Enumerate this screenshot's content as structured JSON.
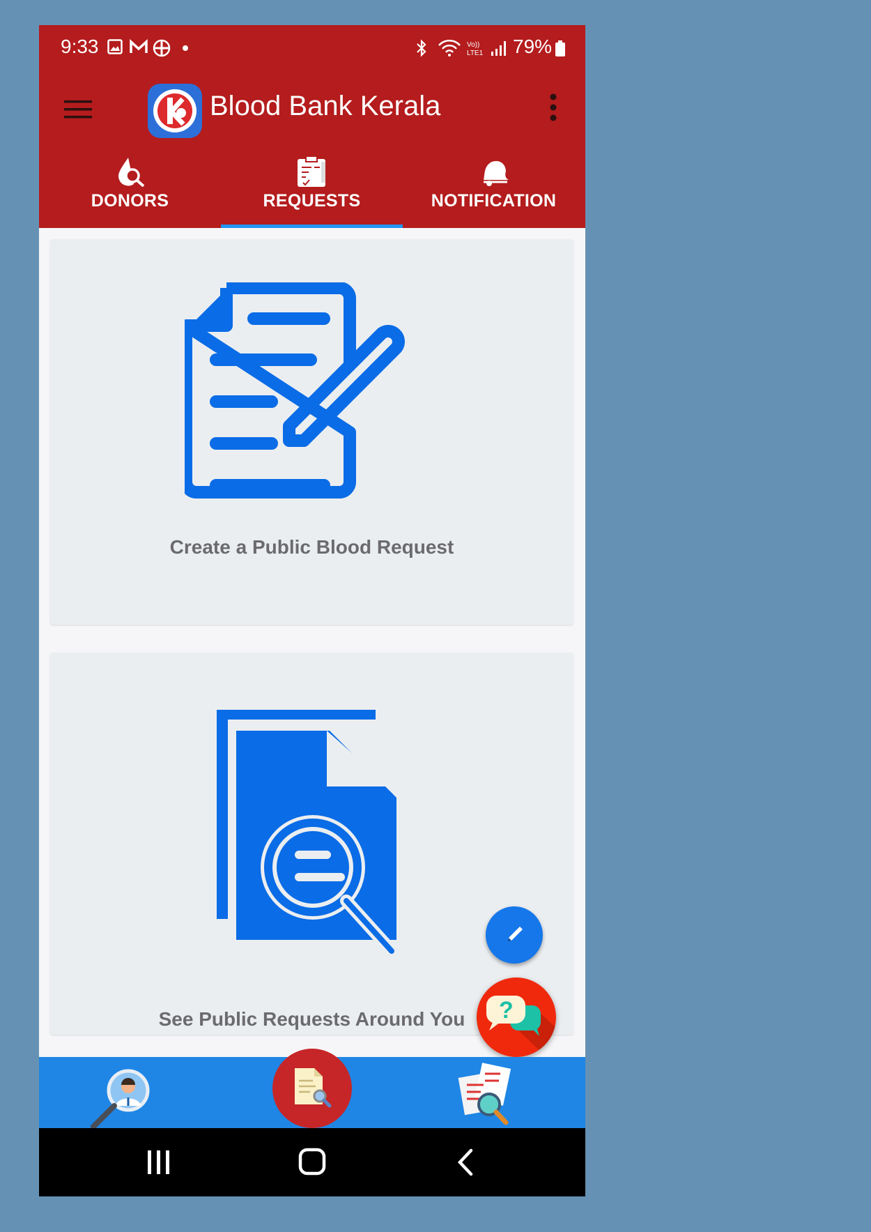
{
  "status_bar": {
    "time": "9:33",
    "battery": "79%",
    "icons": [
      "image-icon",
      "gmail-icon",
      "app-icon",
      "dot-icon",
      "bluetooth-icon",
      "wifi-icon",
      "volte-icon",
      "signal-icon",
      "battery-icon"
    ]
  },
  "app_bar": {
    "title": "Blood Bank Kerala",
    "menu_icon": "hamburger-menu-icon",
    "overflow_icon": "more-vert-icon",
    "logo": "blood-bank-kerala-logo"
  },
  "tabs": [
    {
      "label": "DONORS",
      "icon": "blood-drop-search-icon"
    },
    {
      "label": "REQUESTS",
      "icon": "clipboard-icon",
      "selected": true
    },
    {
      "label": "NOTIFICATION",
      "icon": "bell-icon"
    }
  ],
  "cards": [
    {
      "label": "Create a Public Blood Request",
      "icon": "document-edit-icon"
    },
    {
      "label": "See Public  Requests Around You",
      "icon": "document-search-icon"
    }
  ],
  "fabs": {
    "edit": "pencil-icon",
    "help": "help-chat-icon"
  },
  "bottom_nav": [
    "donor-search-icon",
    "request-document-icon",
    "requests-search-icon"
  ],
  "colors": {
    "primary": "#b41c1d",
    "accent": "#2196f3",
    "icon_blue": "#0a6ce6",
    "bottom_nav": "#1f86e5",
    "background": "#6592b4"
  }
}
